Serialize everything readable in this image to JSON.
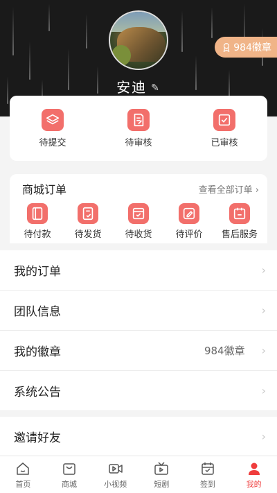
{
  "profile": {
    "name": "安迪",
    "badge_count_label": "984徽章"
  },
  "review": {
    "items": [
      {
        "label": "待提交",
        "icon": "layers-icon"
      },
      {
        "label": "待审核",
        "icon": "doc-edit-icon"
      },
      {
        "label": "已审核",
        "icon": "shield-check-icon"
      }
    ]
  },
  "orders": {
    "title": "商城订单",
    "view_all": "查看全部订单",
    "items": [
      {
        "label": "待付款",
        "icon": "wallet-icon"
      },
      {
        "label": "待发货",
        "icon": "clipboard-check-icon"
      },
      {
        "label": "待收货",
        "icon": "inbox-check-icon"
      },
      {
        "label": "待评价",
        "icon": "edit-icon"
      },
      {
        "label": "售后服务",
        "icon": "calendar-service-icon"
      }
    ]
  },
  "menu": {
    "my_orders": "我的订单",
    "team_info": "团队信息",
    "my_badges": "我的徽章",
    "my_badges_value": "984徽章",
    "announcements": "系统公告",
    "invite": "邀请好友"
  },
  "tabbar": {
    "items": [
      {
        "label": "首页",
        "icon": "home-icon"
      },
      {
        "label": "商城",
        "icon": "shopping-bag-icon"
      },
      {
        "label": "小视频",
        "icon": "video-icon"
      },
      {
        "label": "短剧",
        "icon": "tv-icon"
      },
      {
        "label": "签到",
        "icon": "calendar-check-icon"
      },
      {
        "label": "我的",
        "icon": "user-icon"
      }
    ],
    "active_index": 5,
    "active_color": "#ef3d3d"
  },
  "colors": {
    "accent": "#f26f6b",
    "badge_pill": "#f0b488",
    "header_bg": "#1a1a1a"
  }
}
